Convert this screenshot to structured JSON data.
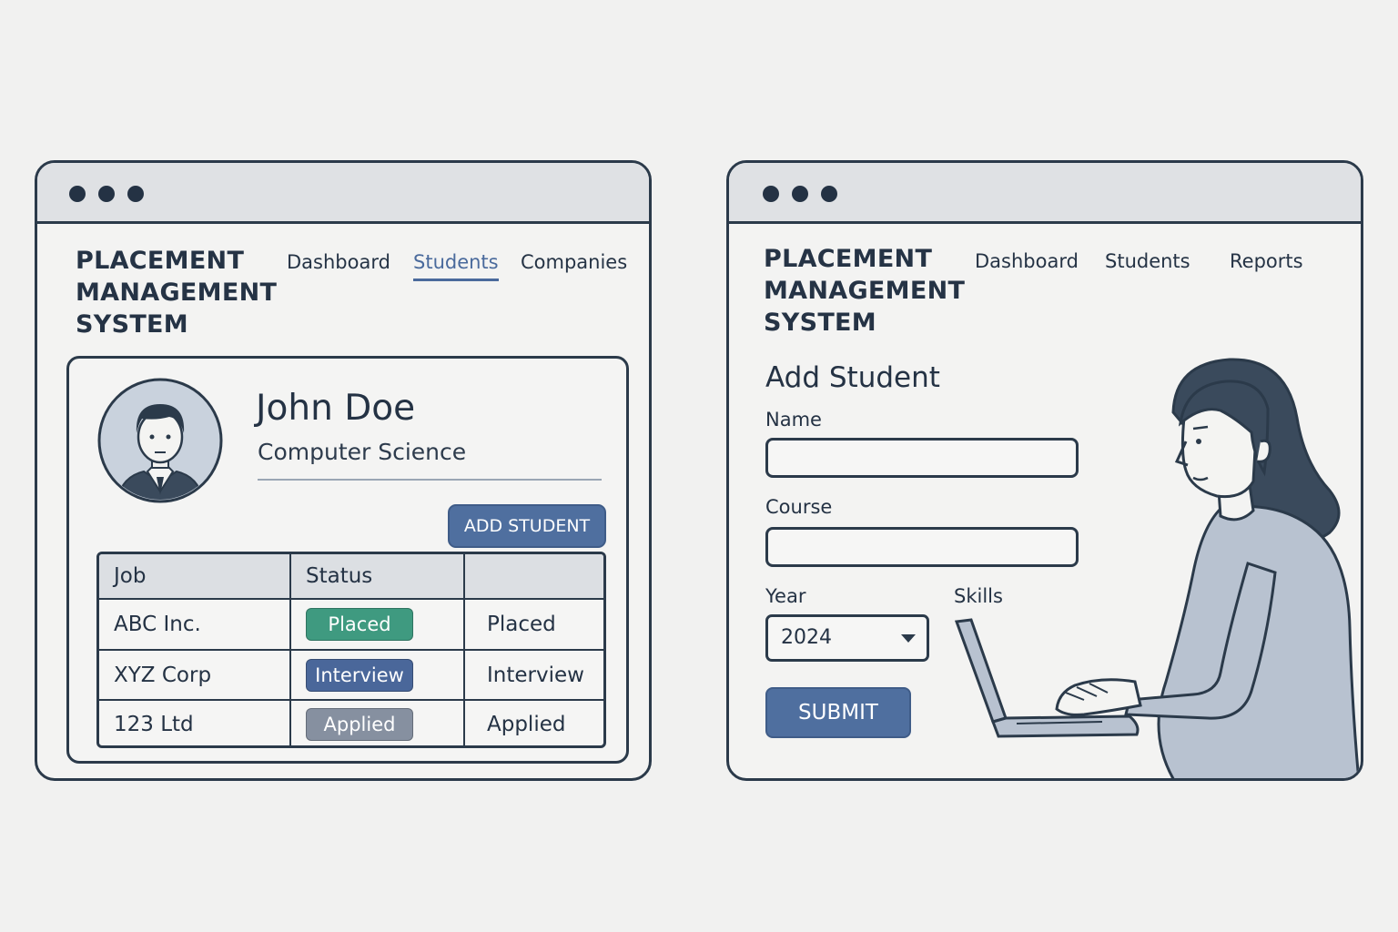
{
  "left_window": {
    "brand": "PLACEMENT\nMANAGEMENT\nSYSTEM",
    "nav": [
      "Dashboard",
      "Students",
      "Companies"
    ],
    "active_nav": "Students",
    "profile": {
      "name": "John Doe",
      "course": "Computer Science"
    },
    "add_button": "ADD STUDENT",
    "table": {
      "headers": [
        "Job",
        "Status",
        ""
      ],
      "rows": [
        {
          "job": "ABC Inc.",
          "badge": "Placed",
          "status": "Placed"
        },
        {
          "job": "XYZ Corp",
          "badge": "Interview",
          "status": "Interview"
        },
        {
          "job": "123 Ltd",
          "badge": "Applied",
          "status": "Applied"
        }
      ]
    },
    "badge_colors": {
      "Placed": "#3f9a80",
      "Interview": "#4a679a",
      "Applied": "#8690a0"
    }
  },
  "right_window": {
    "brand": "PLACEMENT\nMANAGEMENT\nSYSTEM",
    "nav": [
      "Dashboard",
      "Students",
      "Reports"
    ],
    "form": {
      "title": "Add Student",
      "name_label": "Name",
      "name_value": "",
      "course_label": "Course",
      "course_value": "",
      "year_label": "Year",
      "year_value": "2024",
      "skills_label": "Skills",
      "submit": "SUBMIT"
    }
  },
  "colors": {
    "accent": "#4f6f9f",
    "outline": "#2b3a4a",
    "titlebar": "#dfe1e4"
  }
}
